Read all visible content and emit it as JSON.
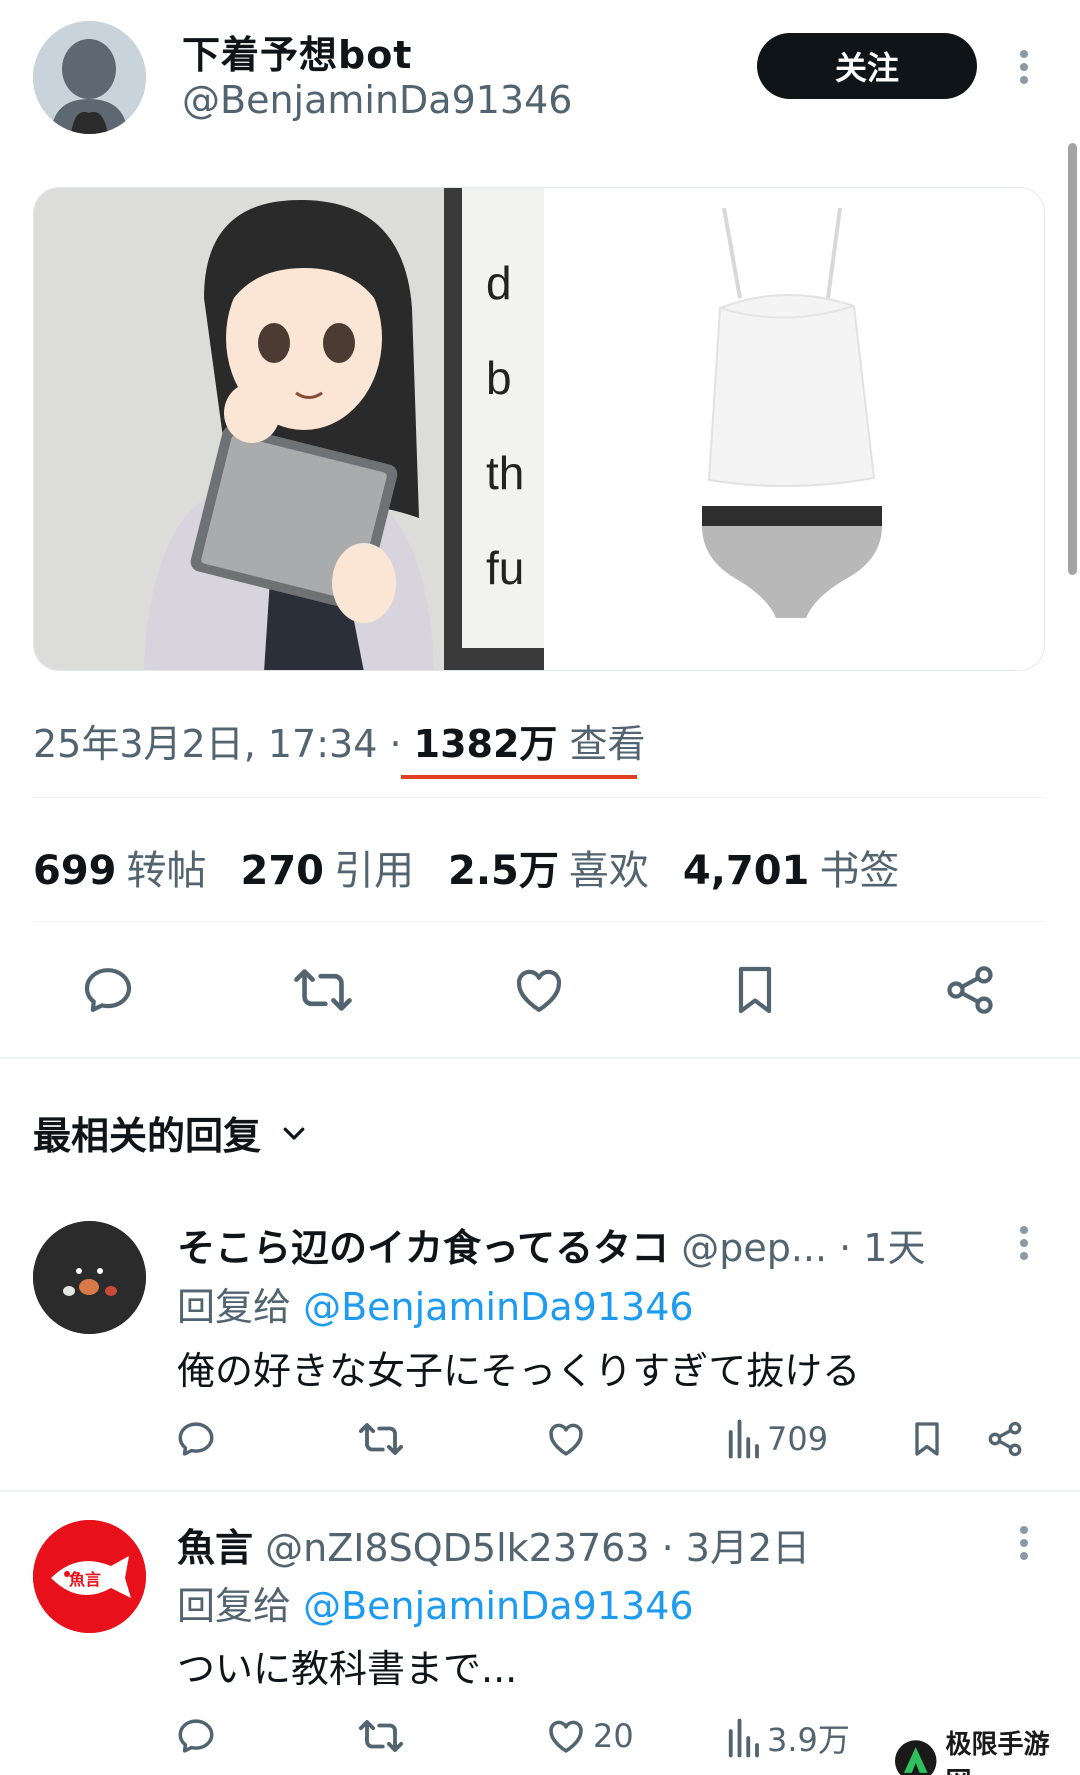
{
  "header": {
    "display_name": "下着予想bot",
    "handle": "@BenjaminDa91346",
    "follow_label": "关注"
  },
  "tweet": {
    "datetime": "25年3月2日, 17:34 · ",
    "views_count": "1382万",
    "views_label": " 查看",
    "stats": [
      {
        "count": "699",
        "label": "转帖"
      },
      {
        "count": "270",
        "label": "引用"
      },
      {
        "count": "2.5万",
        "label": "喜欢"
      },
      {
        "count": "4,701",
        "label": "书签"
      }
    ],
    "actions": [
      "reply-icon",
      "retweet-icon",
      "like-icon",
      "bookmark-icon",
      "share-icon"
    ],
    "media_text_fragments": [
      "d",
      "b",
      "th",
      "fu"
    ]
  },
  "replies_sort": {
    "label": "最相关的回复"
  },
  "replies": [
    {
      "name": "そこら辺のイカ食ってるタコ",
      "handle": "@pep...",
      "time": " · 1天",
      "reply_to_prefix": "回复给 ",
      "reply_to": "@BenjaminDa91346",
      "text": "俺の好きな女子にそっくりすぎて抜ける",
      "like_count": "",
      "view_count": "709"
    },
    {
      "name": "魚言",
      "handle": "@nZI8SQD5lk23763",
      "time": " · 3月2日",
      "reply_to_prefix": "回复给 ",
      "reply_to": "@BenjaminDa91346",
      "text": "ついに教科書まで...",
      "like_count": "20",
      "view_count": "3.9万",
      "avatar_text": "魚言"
    }
  ],
  "watermark": {
    "text": "极限手游网"
  },
  "colors": {
    "accent_link": "#1d9bf0",
    "underline": "#e0401f",
    "follow_bg": "#0f1419",
    "reply2_avatar": "#e8101a"
  }
}
